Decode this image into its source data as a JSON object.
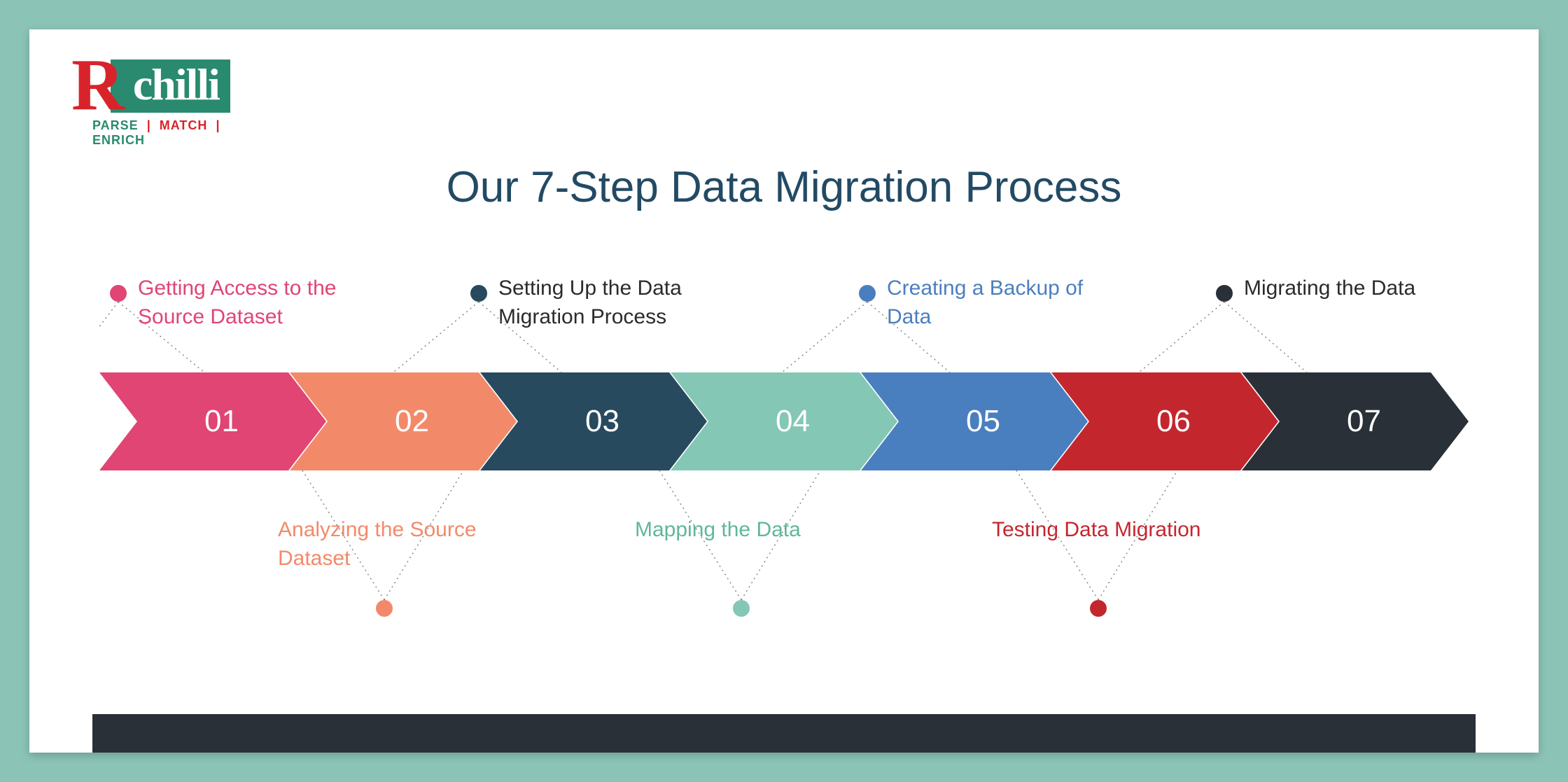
{
  "logo": {
    "r": "R",
    "box": "chilli",
    "tag_parse": "PARSE",
    "tag_match": "MATCH",
    "tag_enrich": "ENRICH"
  },
  "title": "Our 7-Step Data Migration Process",
  "steps": [
    {
      "num": "01",
      "label": "Getting Access to the Source Dataset",
      "color": "#e04574",
      "text_color": "#e04574",
      "pos": "top"
    },
    {
      "num": "02",
      "label": "Analyzing the Source Dataset",
      "color": "#f28a6a",
      "text_color": "#f28a6a",
      "pos": "bottom"
    },
    {
      "num": "03",
      "label": "Setting Up the Data Migration Process",
      "color": "#274a5f",
      "text_color": "#2b2b2b",
      "pos": "top"
    },
    {
      "num": "04",
      "label": "Mapping the Data",
      "color": "#84c7b5",
      "text_color": "#5fb79d",
      "pos": "bottom"
    },
    {
      "num": "05",
      "label": "Creating a Backup of Data",
      "color": "#4a7fbf",
      "text_color": "#4a7fbf",
      "pos": "top"
    },
    {
      "num": "06",
      "label": "Testing Data Migration",
      "color": "#c4262e",
      "text_color": "#c4262e",
      "pos": "bottom"
    },
    {
      "num": "07",
      "label": "Migrating the Data",
      "color": "#2a3038",
      "text_color": "#2b2b2b",
      "pos": "top"
    }
  ],
  "chart_data": {
    "type": "process-flow",
    "title": "Our 7-Step Data Migration Process",
    "categories": [
      "01",
      "02",
      "03",
      "04",
      "05",
      "06",
      "07"
    ],
    "series": [
      {
        "name": "step",
        "values": [
          "Getting Access to the Source Dataset",
          "Analyzing the Source Dataset",
          "Setting Up the Data Migration Process",
          "Mapping the Data",
          "Creating a Backup of Data",
          "Testing Data Migration",
          "Migrating the Data"
        ]
      }
    ],
    "xlabel": "",
    "ylabel": "",
    "ylim": null
  }
}
